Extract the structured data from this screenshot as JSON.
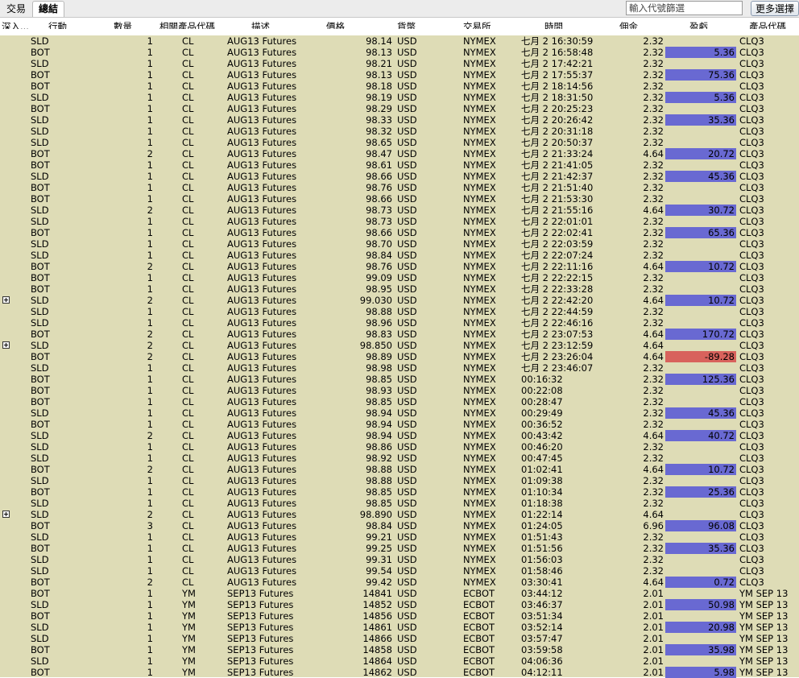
{
  "tabs": [
    {
      "label": "交易",
      "active": false
    },
    {
      "label": "總結",
      "active": true
    }
  ],
  "filter": {
    "placeholder": "輸入代號篩選"
  },
  "more_button": {
    "label": "更多選擇"
  },
  "colors": {
    "grid_bg": "#dedcb6",
    "profit": "#6969d2",
    "loss": "#d8625c"
  },
  "columns": {
    "drill": "深入...",
    "action": "行動",
    "qty": "數量",
    "symbol": "相關產品代碼",
    "description": "描述",
    "price": "價格",
    "currency": "貨幣",
    "exchange": "交易所",
    "time": "時間",
    "commission": "佣金",
    "pnl": "盈虧",
    "code": "產品代碼"
  },
  "rows": [
    {
      "action": "SLD",
      "qty": "1",
      "symbol": "CL",
      "description": "AUG13 Futures",
      "price": "98.14",
      "currency": "USD",
      "exchange": "NYMEX",
      "time": "七月 2 16:30:59",
      "commission": "2.32",
      "pnl": "",
      "code": "CLQ3"
    },
    {
      "action": "BOT",
      "qty": "1",
      "symbol": "CL",
      "description": "AUG13 Futures",
      "price": "98.13",
      "currency": "USD",
      "exchange": "NYMEX",
      "time": "七月 2 16:58:48",
      "commission": "2.32",
      "pnl": "5.36",
      "code": "CLQ3"
    },
    {
      "action": "SLD",
      "qty": "1",
      "symbol": "CL",
      "description": "AUG13 Futures",
      "price": "98.21",
      "currency": "USD",
      "exchange": "NYMEX",
      "time": "七月 2 17:42:21",
      "commission": "2.32",
      "pnl": "",
      "code": "CLQ3"
    },
    {
      "action": "BOT",
      "qty": "1",
      "symbol": "CL",
      "description": "AUG13 Futures",
      "price": "98.13",
      "currency": "USD",
      "exchange": "NYMEX",
      "time": "七月 2 17:55:37",
      "commission": "2.32",
      "pnl": "75.36",
      "code": "CLQ3"
    },
    {
      "action": "BOT",
      "qty": "1",
      "symbol": "CL",
      "description": "AUG13 Futures",
      "price": "98.18",
      "currency": "USD",
      "exchange": "NYMEX",
      "time": "七月 2 18:14:56",
      "commission": "2.32",
      "pnl": "",
      "code": "CLQ3"
    },
    {
      "action": "SLD",
      "qty": "1",
      "symbol": "CL",
      "description": "AUG13 Futures",
      "price": "98.19",
      "currency": "USD",
      "exchange": "NYMEX",
      "time": "七月 2 18:31:50",
      "commission": "2.32",
      "pnl": "5.36",
      "code": "CLQ3"
    },
    {
      "action": "BOT",
      "qty": "1",
      "symbol": "CL",
      "description": "AUG13 Futures",
      "price": "98.29",
      "currency": "USD",
      "exchange": "NYMEX",
      "time": "七月 2 20:25:23",
      "commission": "2.32",
      "pnl": "",
      "code": "CLQ3"
    },
    {
      "action": "SLD",
      "qty": "1",
      "symbol": "CL",
      "description": "AUG13 Futures",
      "price": "98.33",
      "currency": "USD",
      "exchange": "NYMEX",
      "time": "七月 2 20:26:42",
      "commission": "2.32",
      "pnl": "35.36",
      "code": "CLQ3"
    },
    {
      "action": "SLD",
      "qty": "1",
      "symbol": "CL",
      "description": "AUG13 Futures",
      "price": "98.32",
      "currency": "USD",
      "exchange": "NYMEX",
      "time": "七月 2 20:31:18",
      "commission": "2.32",
      "pnl": "",
      "code": "CLQ3"
    },
    {
      "action": "SLD",
      "qty": "1",
      "symbol": "CL",
      "description": "AUG13 Futures",
      "price": "98.65",
      "currency": "USD",
      "exchange": "NYMEX",
      "time": "七月 2 20:50:37",
      "commission": "2.32",
      "pnl": "",
      "code": "CLQ3"
    },
    {
      "action": "BOT",
      "qty": "2",
      "symbol": "CL",
      "description": "AUG13 Futures",
      "price": "98.47",
      "currency": "USD",
      "exchange": "NYMEX",
      "time": "七月 2 21:33:24",
      "commission": "4.64",
      "pnl": "20.72",
      "code": "CLQ3"
    },
    {
      "action": "BOT",
      "qty": "1",
      "symbol": "CL",
      "description": "AUG13 Futures",
      "price": "98.61",
      "currency": "USD",
      "exchange": "NYMEX",
      "time": "七月 2 21:41:05",
      "commission": "2.32",
      "pnl": "",
      "code": "CLQ3"
    },
    {
      "action": "SLD",
      "qty": "1",
      "symbol": "CL",
      "description": "AUG13 Futures",
      "price": "98.66",
      "currency": "USD",
      "exchange": "NYMEX",
      "time": "七月 2 21:42:37",
      "commission": "2.32",
      "pnl": "45.36",
      "code": "CLQ3"
    },
    {
      "action": "BOT",
      "qty": "1",
      "symbol": "CL",
      "description": "AUG13 Futures",
      "price": "98.76",
      "currency": "USD",
      "exchange": "NYMEX",
      "time": "七月 2 21:51:40",
      "commission": "2.32",
      "pnl": "",
      "code": "CLQ3"
    },
    {
      "action": "BOT",
      "qty": "1",
      "symbol": "CL",
      "description": "AUG13 Futures",
      "price": "98.66",
      "currency": "USD",
      "exchange": "NYMEX",
      "time": "七月 2 21:53:30",
      "commission": "2.32",
      "pnl": "",
      "code": "CLQ3"
    },
    {
      "action": "SLD",
      "qty": "2",
      "symbol": "CL",
      "description": "AUG13 Futures",
      "price": "98.73",
      "currency": "USD",
      "exchange": "NYMEX",
      "time": "七月 2 21:55:16",
      "commission": "4.64",
      "pnl": "30.72",
      "code": "CLQ3"
    },
    {
      "action": "SLD",
      "qty": "1",
      "symbol": "CL",
      "description": "AUG13 Futures",
      "price": "98.73",
      "currency": "USD",
      "exchange": "NYMEX",
      "time": "七月 2 22:01:01",
      "commission": "2.32",
      "pnl": "",
      "code": "CLQ3"
    },
    {
      "action": "BOT",
      "qty": "1",
      "symbol": "CL",
      "description": "AUG13 Futures",
      "price": "98.66",
      "currency": "USD",
      "exchange": "NYMEX",
      "time": "七月 2 22:02:41",
      "commission": "2.32",
      "pnl": "65.36",
      "code": "CLQ3"
    },
    {
      "action": "SLD",
      "qty": "1",
      "symbol": "CL",
      "description": "AUG13 Futures",
      "price": "98.70",
      "currency": "USD",
      "exchange": "NYMEX",
      "time": "七月 2 22:03:59",
      "commission": "2.32",
      "pnl": "",
      "code": "CLQ3"
    },
    {
      "action": "SLD",
      "qty": "1",
      "symbol": "CL",
      "description": "AUG13 Futures",
      "price": "98.84",
      "currency": "USD",
      "exchange": "NYMEX",
      "time": "七月 2 22:07:24",
      "commission": "2.32",
      "pnl": "",
      "code": "CLQ3"
    },
    {
      "action": "BOT",
      "qty": "2",
      "symbol": "CL",
      "description": "AUG13 Futures",
      "price": "98.76",
      "currency": "USD",
      "exchange": "NYMEX",
      "time": "七月 2 22:11:16",
      "commission": "4.64",
      "pnl": "10.72",
      "code": "CLQ3"
    },
    {
      "action": "BOT",
      "qty": "1",
      "symbol": "CL",
      "description": "AUG13 Futures",
      "price": "99.09",
      "currency": "USD",
      "exchange": "NYMEX",
      "time": "七月 2 22:22:15",
      "commission": "2.32",
      "pnl": "",
      "code": "CLQ3"
    },
    {
      "action": "BOT",
      "qty": "1",
      "symbol": "CL",
      "description": "AUG13 Futures",
      "price": "98.95",
      "currency": "USD",
      "exchange": "NYMEX",
      "time": "七月 2 22:33:28",
      "commission": "2.32",
      "pnl": "",
      "code": "CLQ3"
    },
    {
      "expandable": true,
      "action": "SLD",
      "qty": "2",
      "symbol": "CL",
      "description": "AUG13 Futures",
      "price": "99.030",
      "currency": "USD",
      "exchange": "NYMEX",
      "time": "七月 2 22:42:20",
      "commission": "4.64",
      "pnl": "10.72",
      "code": "CLQ3"
    },
    {
      "action": "SLD",
      "qty": "1",
      "symbol": "CL",
      "description": "AUG13 Futures",
      "price": "98.88",
      "currency": "USD",
      "exchange": "NYMEX",
      "time": "七月 2 22:44:59",
      "commission": "2.32",
      "pnl": "",
      "code": "CLQ3"
    },
    {
      "action": "SLD",
      "qty": "1",
      "symbol": "CL",
      "description": "AUG13 Futures",
      "price": "98.96",
      "currency": "USD",
      "exchange": "NYMEX",
      "time": "七月 2 22:46:16",
      "commission": "2.32",
      "pnl": "",
      "code": "CLQ3"
    },
    {
      "action": "BOT",
      "qty": "2",
      "symbol": "CL",
      "description": "AUG13 Futures",
      "price": "98.83",
      "currency": "USD",
      "exchange": "NYMEX",
      "time": "七月 2 23:07:53",
      "commission": "4.64",
      "pnl": "170.72",
      "code": "CLQ3"
    },
    {
      "expandable": true,
      "action": "SLD",
      "qty": "2",
      "symbol": "CL",
      "description": "AUG13 Futures",
      "price": "98.850",
      "currency": "USD",
      "exchange": "NYMEX",
      "time": "七月 2 23:12:59",
      "commission": "4.64",
      "pnl": "",
      "code": "CLQ3"
    },
    {
      "action": "BOT",
      "qty": "2",
      "symbol": "CL",
      "description": "AUG13 Futures",
      "price": "98.89",
      "currency": "USD",
      "exchange": "NYMEX",
      "time": "七月 2 23:26:04",
      "commission": "4.64",
      "pnl": "-89.28",
      "code": "CLQ3"
    },
    {
      "action": "SLD",
      "qty": "1",
      "symbol": "CL",
      "description": "AUG13 Futures",
      "price": "98.98",
      "currency": "USD",
      "exchange": "NYMEX",
      "time": "七月 2 23:46:07",
      "commission": "2.32",
      "pnl": "",
      "code": "CLQ3"
    },
    {
      "action": "BOT",
      "qty": "1",
      "symbol": "CL",
      "description": "AUG13 Futures",
      "price": "98.85",
      "currency": "USD",
      "exchange": "NYMEX",
      "time": "00:16:32",
      "commission": "2.32",
      "pnl": "125.36",
      "code": "CLQ3"
    },
    {
      "action": "BOT",
      "qty": "1",
      "symbol": "CL",
      "description": "AUG13 Futures",
      "price": "98.93",
      "currency": "USD",
      "exchange": "NYMEX",
      "time": "00:22:08",
      "commission": "2.32",
      "pnl": "",
      "code": "CLQ3"
    },
    {
      "action": "BOT",
      "qty": "1",
      "symbol": "CL",
      "description": "AUG13 Futures",
      "price": "98.85",
      "currency": "USD",
      "exchange": "NYMEX",
      "time": "00:28:47",
      "commission": "2.32",
      "pnl": "",
      "code": "CLQ3"
    },
    {
      "action": "SLD",
      "qty": "1",
      "symbol": "CL",
      "description": "AUG13 Futures",
      "price": "98.94",
      "currency": "USD",
      "exchange": "NYMEX",
      "time": "00:29:49",
      "commission": "2.32",
      "pnl": "45.36",
      "code": "CLQ3"
    },
    {
      "action": "BOT",
      "qty": "1",
      "symbol": "CL",
      "description": "AUG13 Futures",
      "price": "98.94",
      "currency": "USD",
      "exchange": "NYMEX",
      "time": "00:36:52",
      "commission": "2.32",
      "pnl": "",
      "code": "CLQ3"
    },
    {
      "action": "SLD",
      "qty": "2",
      "symbol": "CL",
      "description": "AUG13 Futures",
      "price": "98.94",
      "currency": "USD",
      "exchange": "NYMEX",
      "time": "00:43:42",
      "commission": "4.64",
      "pnl": "40.72",
      "code": "CLQ3"
    },
    {
      "action": "SLD",
      "qty": "1",
      "symbol": "CL",
      "description": "AUG13 Futures",
      "price": "98.86",
      "currency": "USD",
      "exchange": "NYMEX",
      "time": "00:46:20",
      "commission": "2.32",
      "pnl": "",
      "code": "CLQ3"
    },
    {
      "action": "SLD",
      "qty": "1",
      "symbol": "CL",
      "description": "AUG13 Futures",
      "price": "98.92",
      "currency": "USD",
      "exchange": "NYMEX",
      "time": "00:47:45",
      "commission": "2.32",
      "pnl": "",
      "code": "CLQ3"
    },
    {
      "action": "BOT",
      "qty": "2",
      "symbol": "CL",
      "description": "AUG13 Futures",
      "price": "98.88",
      "currency": "USD",
      "exchange": "NYMEX",
      "time": "01:02:41",
      "commission": "4.64",
      "pnl": "10.72",
      "code": "CLQ3"
    },
    {
      "action": "SLD",
      "qty": "1",
      "symbol": "CL",
      "description": "AUG13 Futures",
      "price": "98.88",
      "currency": "USD",
      "exchange": "NYMEX",
      "time": "01:09:38",
      "commission": "2.32",
      "pnl": "",
      "code": "CLQ3"
    },
    {
      "action": "BOT",
      "qty": "1",
      "symbol": "CL",
      "description": "AUG13 Futures",
      "price": "98.85",
      "currency": "USD",
      "exchange": "NYMEX",
      "time": "01:10:34",
      "commission": "2.32",
      "pnl": "25.36",
      "code": "CLQ3"
    },
    {
      "action": "SLD",
      "qty": "1",
      "symbol": "CL",
      "description": "AUG13 Futures",
      "price": "98.85",
      "currency": "USD",
      "exchange": "NYMEX",
      "time": "01:18:38",
      "commission": "2.32",
      "pnl": "",
      "code": "CLQ3"
    },
    {
      "expandable": true,
      "action": "SLD",
      "qty": "2",
      "symbol": "CL",
      "description": "AUG13 Futures",
      "price": "98.890",
      "currency": "USD",
      "exchange": "NYMEX",
      "time": "01:22:14",
      "commission": "4.64",
      "pnl": "",
      "code": "CLQ3"
    },
    {
      "action": "BOT",
      "qty": "3",
      "symbol": "CL",
      "description": "AUG13 Futures",
      "price": "98.84",
      "currency": "USD",
      "exchange": "NYMEX",
      "time": "01:24:05",
      "commission": "6.96",
      "pnl": "96.08",
      "code": "CLQ3"
    },
    {
      "action": "SLD",
      "qty": "1",
      "symbol": "CL",
      "description": "AUG13 Futures",
      "price": "99.21",
      "currency": "USD",
      "exchange": "NYMEX",
      "time": "01:51:43",
      "commission": "2.32",
      "pnl": "",
      "code": "CLQ3"
    },
    {
      "action": "BOT",
      "qty": "1",
      "symbol": "CL",
      "description": "AUG13 Futures",
      "price": "99.25",
      "currency": "USD",
      "exchange": "NYMEX",
      "time": "01:51:56",
      "commission": "2.32",
      "pnl": "35.36",
      "code": "CLQ3"
    },
    {
      "action": "SLD",
      "qty": "1",
      "symbol": "CL",
      "description": "AUG13 Futures",
      "price": "99.31",
      "currency": "USD",
      "exchange": "NYMEX",
      "time": "01:56:03",
      "commission": "2.32",
      "pnl": "",
      "code": "CLQ3"
    },
    {
      "action": "SLD",
      "qty": "1",
      "symbol": "CL",
      "description": "AUG13 Futures",
      "price": "99.54",
      "currency": "USD",
      "exchange": "NYMEX",
      "time": "01:58:46",
      "commission": "2.32",
      "pnl": "",
      "code": "CLQ3"
    },
    {
      "action": "BOT",
      "qty": "2",
      "symbol": "CL",
      "description": "AUG13 Futures",
      "price": "99.42",
      "currency": "USD",
      "exchange": "NYMEX",
      "time": "03:30:41",
      "commission": "4.64",
      "pnl": "0.72",
      "code": "CLQ3"
    },
    {
      "action": "BOT",
      "qty": "1",
      "symbol": "YM",
      "description": "SEP13 Futures",
      "price": "14841",
      "currency": "USD",
      "exchange": "ECBOT",
      "time": "03:44:12",
      "commission": "2.01",
      "pnl": "",
      "code": "YM  SEP 13"
    },
    {
      "action": "SLD",
      "qty": "1",
      "symbol": "YM",
      "description": "SEP13 Futures",
      "price": "14852",
      "currency": "USD",
      "exchange": "ECBOT",
      "time": "03:46:37",
      "commission": "2.01",
      "pnl": "50.98",
      "code": "YM  SEP 13"
    },
    {
      "action": "BOT",
      "qty": "1",
      "symbol": "YM",
      "description": "SEP13 Futures",
      "price": "14856",
      "currency": "USD",
      "exchange": "ECBOT",
      "time": "03:51:34",
      "commission": "2.01",
      "pnl": "",
      "code": "YM  SEP 13"
    },
    {
      "action": "SLD",
      "qty": "1",
      "symbol": "YM",
      "description": "SEP13 Futures",
      "price": "14861",
      "currency": "USD",
      "exchange": "ECBOT",
      "time": "03:52:14",
      "commission": "2.01",
      "pnl": "20.98",
      "code": "YM  SEP 13"
    },
    {
      "action": "SLD",
      "qty": "1",
      "symbol": "YM",
      "description": "SEP13 Futures",
      "price": "14866",
      "currency": "USD",
      "exchange": "ECBOT",
      "time": "03:57:47",
      "commission": "2.01",
      "pnl": "",
      "code": "YM  SEP 13"
    },
    {
      "action": "BOT",
      "qty": "1",
      "symbol": "YM",
      "description": "SEP13 Futures",
      "price": "14858",
      "currency": "USD",
      "exchange": "ECBOT",
      "time": "03:59:58",
      "commission": "2.01",
      "pnl": "35.98",
      "code": "YM  SEP 13"
    },
    {
      "action": "SLD",
      "qty": "1",
      "symbol": "YM",
      "description": "SEP13 Futures",
      "price": "14864",
      "currency": "USD",
      "exchange": "ECBOT",
      "time": "04:06:36",
      "commission": "2.01",
      "pnl": "",
      "code": "YM  SEP 13"
    },
    {
      "action": "BOT",
      "qty": "1",
      "symbol": "YM",
      "description": "SEP13 Futures",
      "price": "14862",
      "currency": "USD",
      "exchange": "ECBOT",
      "time": "04:12:11",
      "commission": "2.01",
      "pnl": "5.98",
      "code": "YM  SEP 13"
    }
  ]
}
